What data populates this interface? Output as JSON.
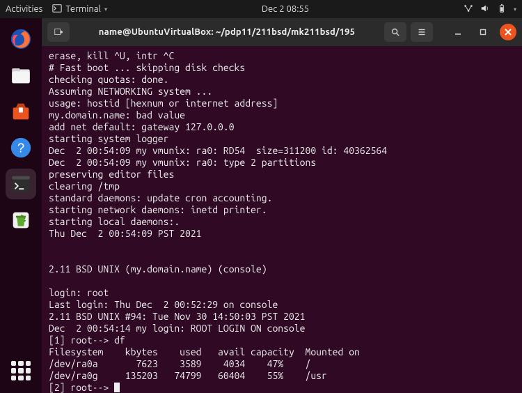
{
  "topbar": {
    "activities": "Activities",
    "app_indicator": "Terminal",
    "clock": "Dec 2  08:55"
  },
  "window": {
    "title": "name@UbuntuVirtualBox: ~/pdp11/211bsd/mk211bsd/195"
  },
  "terminal": {
    "lines": [
      "erase, kill ^U, intr ^C",
      "# Fast boot ... skipping disk checks",
      "checking quotas: done.",
      "Assuming NETWORKING system ...",
      "usage: hostid [hexnum or internet address]",
      "my.domain.name: bad value",
      "add net default: gateway 127.0.0.0",
      "starting system logger",
      "Dec  2 00:54:09 my vmunix: ra0: RD54  size=311200 id: 40362564",
      "Dec  2 00:54:09 my vmunix: ra0: type 2 partitions",
      "preserving editor files",
      "clearing /tmp",
      "standard daemons: update cron accounting.",
      "starting network daemons: inetd printer.",
      "starting local daemons:.",
      "Thu Dec  2 00:54:09 PST 2021",
      "",
      "",
      "2.11 BSD UNIX (my.domain.name) (console)",
      "",
      "login: root",
      "Last login: Thu Dec  2 00:52:29 on console",
      "2.11 BSD UNIX #94: Tue Nov 30 14:50:03 PST 2021",
      "Dec  2 00:54:14 my login: ROOT LOGIN ON console",
      "[1] root--> df",
      "Filesystem    kbytes    used   avail capacity  Mounted on",
      "/dev/ra0a       7623    3589    4034    47%    /",
      "/dev/ra0g     135203   74799   60404    55%    /usr"
    ],
    "prompt": "[2] root--> "
  }
}
